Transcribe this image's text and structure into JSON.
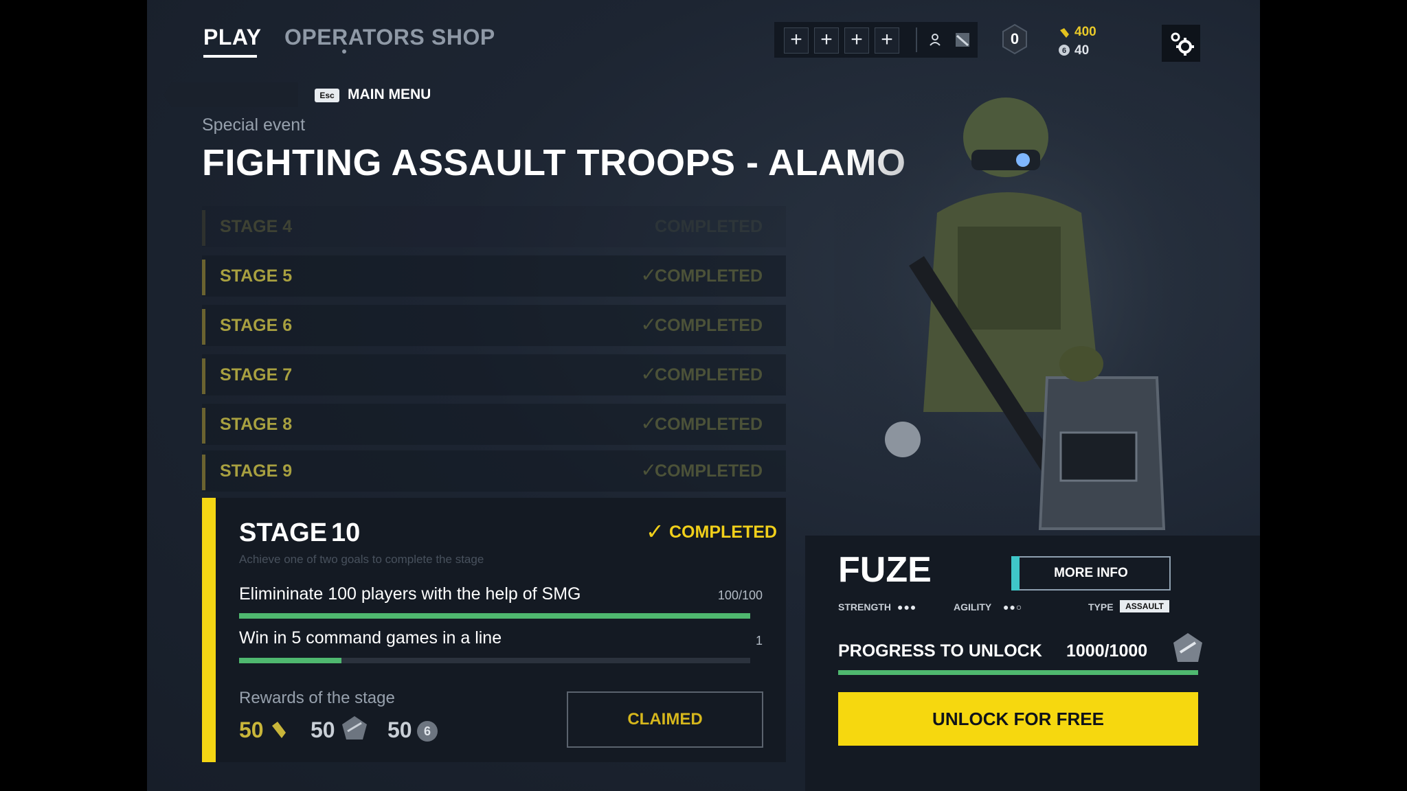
{
  "nav": {
    "tabs": [
      {
        "label": "PLAY",
        "active": true
      },
      {
        "label": "OPERATORS",
        "active": false
      },
      {
        "label": "SHOP",
        "active": false
      }
    ]
  },
  "topbar": {
    "slots": [
      "+",
      "+",
      "+",
      "+"
    ],
    "level_badge": "0",
    "currency": {
      "gold": "400",
      "silver": "40"
    },
    "icons": [
      "plus-icon",
      "person-icon",
      "knife-icon",
      "hex-badge-icon",
      "gear-icon"
    ]
  },
  "header": {
    "esc_key": "Esc",
    "back_label": "MAIN MENU",
    "subtitle": "Special event",
    "title": "FIGHTING ASSAULT TROOPS - ALAMO"
  },
  "stages": [
    {
      "label": "STAGE 4",
      "status": "COMPLETED"
    },
    {
      "label": "STAGE 5",
      "status": "COMPLETED"
    },
    {
      "label": "STAGE 6",
      "status": "COMPLETED"
    },
    {
      "label": "STAGE 7",
      "status": "COMPLETED"
    },
    {
      "label": "STAGE 8",
      "status": "COMPLETED"
    },
    {
      "label": "STAGE 9",
      "status": "COMPLETED"
    }
  ],
  "active_stage": {
    "title": "STAGE",
    "number": "10",
    "status": "COMPLETED",
    "hint": "Achieve one of two goals to complete the stage",
    "goals": [
      {
        "text": "Elimininate 100 players with the help of SMG",
        "value": "100/100",
        "progress": 1.0
      },
      {
        "text": "Win in 5 command games in a line",
        "value": "1",
        "progress": 0.2
      }
    ],
    "rewards_label": "Rewards of the stage",
    "rewards": [
      {
        "amount": "50",
        "icon": "gold-currency-icon"
      },
      {
        "amount": "50",
        "icon": "xp-wing-icon"
      },
      {
        "amount": "50",
        "icon": "six-coin-icon"
      }
    ],
    "claim_label": "CLAIMED"
  },
  "operator": {
    "name": "FUZE",
    "more_info": "MORE INFO",
    "strength_label": "STRENGTH",
    "strength": "●●●",
    "agility_label": "AGILITY",
    "agility": "●●○",
    "type_label": "TYPE",
    "type_value": "ASSAULT",
    "progress_label": "PROGRESS TO UNLOCK",
    "progress_value": "1000/1000",
    "progress": 1.0,
    "unlock_label": "UNLOCK FOR FREE"
  },
  "colors": {
    "accent_yellow": "#f4d614",
    "progress_green": "#4fb86f",
    "more_info_accent": "#3fc6c8",
    "background": "#1d2532"
  }
}
